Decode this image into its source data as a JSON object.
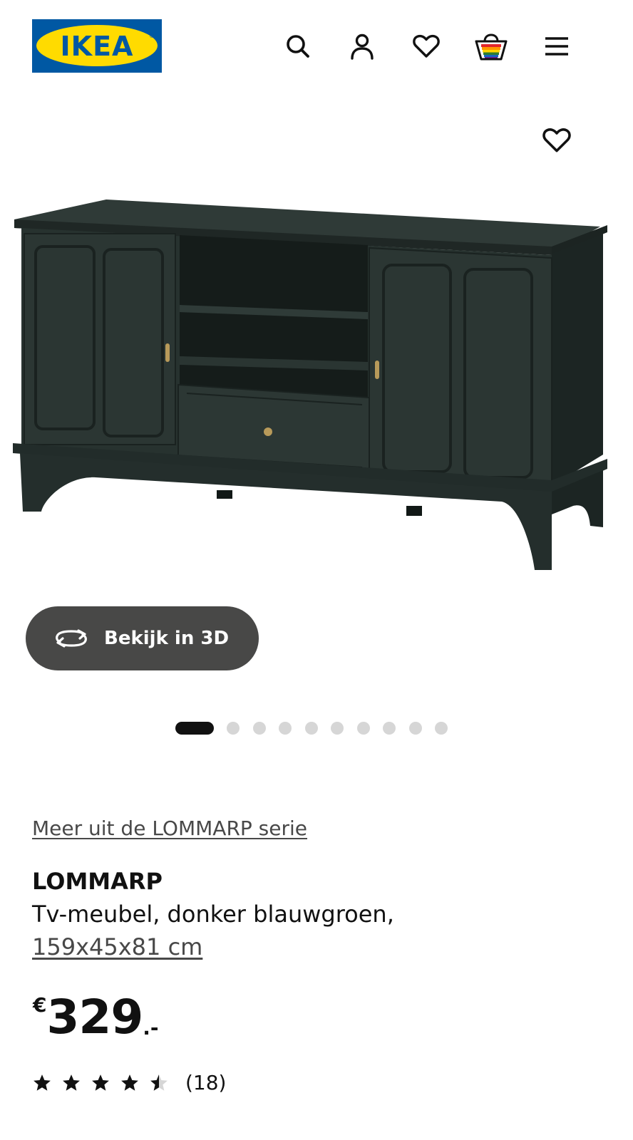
{
  "header": {
    "logo_text": "IKEA",
    "icons": [
      "search-icon",
      "user-icon",
      "heart-icon",
      "basket-icon",
      "menu-icon"
    ]
  },
  "product": {
    "series_link": "Meer uit de LOMMARP serie",
    "name": "LOMMARP",
    "description": "Tv-meubel, donker blauwgroen,",
    "size": "159x45x81 cm",
    "price": {
      "currency": "€",
      "integer": "329",
      "decimal": ".-"
    },
    "rating": {
      "stars": 4.5,
      "count": "(18)"
    }
  },
  "gallery": {
    "view_3d_label": "Bekijk in 3D",
    "current_image": 1,
    "image_count": 10
  },
  "colors": {
    "brand_blue": "#0058a3",
    "brand_yellow": "#ffdb00",
    "product_color": "#27322f",
    "button_bg": "#484847"
  }
}
